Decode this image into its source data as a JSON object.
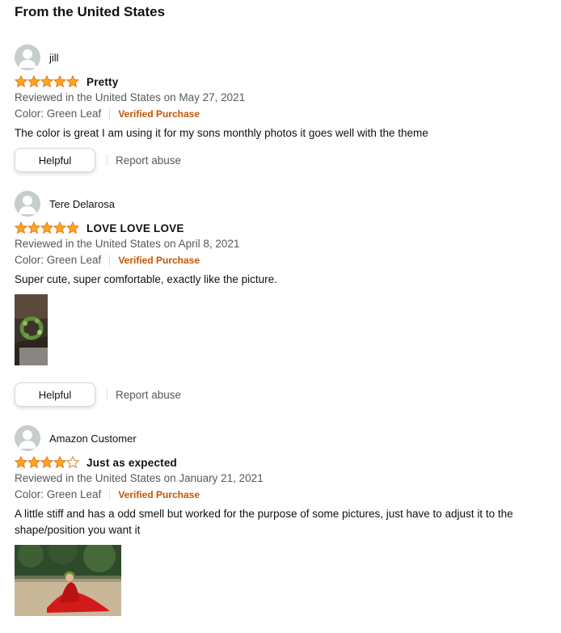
{
  "section": {
    "title": "From the United States"
  },
  "reviews": [
    {
      "profile_name": "jill",
      "rating": 5,
      "title": "Pretty",
      "date": "Reviewed in the United States on May 27, 2021",
      "color": "Color: Green Leaf",
      "verified": "Verified Purchase",
      "body": "The color is great I am using it for my sons monthly photos it goes well with the theme",
      "helpful_label": "Helpful",
      "report_label": "Report abuse"
    },
    {
      "profile_name": "Tere Delarosa",
      "rating": 5,
      "title": "LOVE LOVE LOVE",
      "date": "Reviewed in the United States on April 8, 2021",
      "color": "Color: Green Leaf",
      "verified": "Verified Purchase",
      "body": "Super cute, super comfortable, exactly like the picture.",
      "has_image": true,
      "helpful_label": "Helpful",
      "report_label": "Report abuse"
    },
    {
      "profile_name": "Amazon Customer",
      "rating": 4,
      "title": "Just as expected",
      "date": "Reviewed in the United States on January 21, 2021",
      "color": "Color: Green Leaf",
      "verified": "Verified Purchase",
      "body": "A little stiff and has a odd smell but worked for the purpose of some pictures, just have to adjust it to the shape/position you want it",
      "has_image": true
    }
  ],
  "colors": {
    "star": "#ffa41c",
    "star_outline": "#de7921",
    "verified": "#c45500",
    "muted": "#565959"
  }
}
